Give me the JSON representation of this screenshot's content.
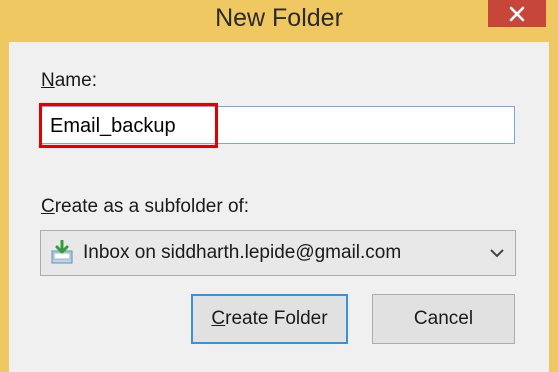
{
  "dialog": {
    "title": "New Folder",
    "close_icon": "close-icon"
  },
  "name_field": {
    "label_accel": "N",
    "label_rest": "ame:",
    "value": "Email_backup"
  },
  "subfolder": {
    "label_accel": "C",
    "label_rest": "reate as a subfolder of:",
    "selected": "Inbox on siddharth.lepide@gmail.com",
    "icon": "inbox-icon"
  },
  "buttons": {
    "create_accel": "C",
    "create_rest": "reate Folder",
    "cancel": "Cancel"
  },
  "colors": {
    "titlebar": "#f0c861",
    "close": "#c7463a",
    "highlight": "#e00000",
    "focus": "#3c8fd9"
  }
}
